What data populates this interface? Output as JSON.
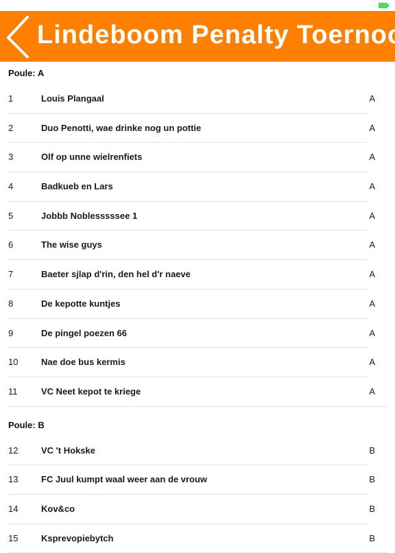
{
  "header": {
    "title": "Lindeboom Penalty Toernooi"
  },
  "sections": [
    {
      "label": "Poule: A",
      "rows": [
        {
          "num": "1",
          "team": "Louis Plangaal",
          "pool": "A"
        },
        {
          "num": "2",
          "team": "Duo Penotti, wae drinke nog un pottie",
          "pool": "A"
        },
        {
          "num": "3",
          "team": "Olf op unne wielrenfiets",
          "pool": "A"
        },
        {
          "num": "4",
          "team": "Badkueb en Lars",
          "pool": "A"
        },
        {
          "num": "5",
          "team": "Jobbb Noblesssssee 1",
          "pool": "A"
        },
        {
          "num": "6",
          "team": "The wise guys",
          "pool": "A"
        },
        {
          "num": "7",
          "team": "Baeter sjlap d'rin, den hel d'r naeve",
          "pool": "A"
        },
        {
          "num": "8",
          "team": "De kepotte kuntjes",
          "pool": "A"
        },
        {
          "num": "9",
          "team": "De pingel poezen 66",
          "pool": "A"
        },
        {
          "num": "10",
          "team": "Nae doe bus kermis",
          "pool": "A"
        },
        {
          "num": "11",
          "team": "VC Neet kepot te kriege",
          "pool": "A"
        }
      ]
    },
    {
      "label": "Poule: B",
      "rows": [
        {
          "num": "12",
          "team": "VC 't Hokske",
          "pool": "B"
        },
        {
          "num": "13",
          "team": "FC Juul kumpt waal weer aan de vrouw",
          "pool": "B"
        },
        {
          "num": "14",
          "team": "Kov&co",
          "pool": "B"
        },
        {
          "num": "15",
          "team": "Ksprevopiebytch",
          "pool": "B"
        }
      ]
    }
  ]
}
